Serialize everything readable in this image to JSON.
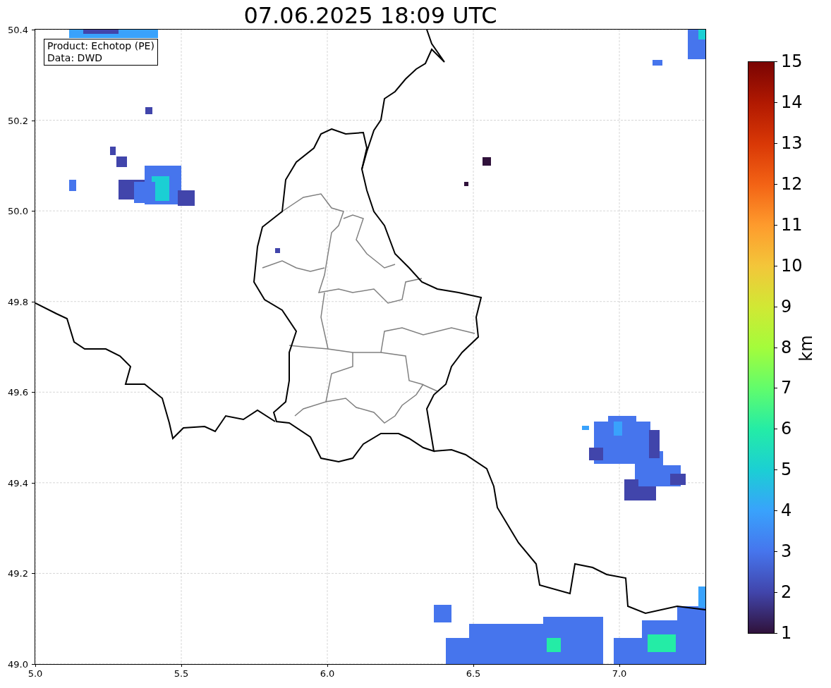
{
  "title": "07.06.2025 18:09 UTC",
  "info_box": {
    "lines": [
      "Product: Echotop (PE)",
      "Data: DWD"
    ]
  },
  "map": {
    "x_ticks": [
      "5.0",
      "5.5",
      "6.0",
      "6.5",
      "7.0"
    ],
    "y_ticks": [
      "50.4",
      "50.2",
      "50.0",
      "49.8",
      "49.6",
      "49.4",
      "49.2",
      "49.0"
    ]
  },
  "colorbar": {
    "label": "km",
    "ticks": [
      "15",
      "14",
      "13",
      "12",
      "11",
      "10",
      "9",
      "8",
      "7",
      "6",
      "5",
      "4",
      "3",
      "2",
      "1"
    ]
  }
}
